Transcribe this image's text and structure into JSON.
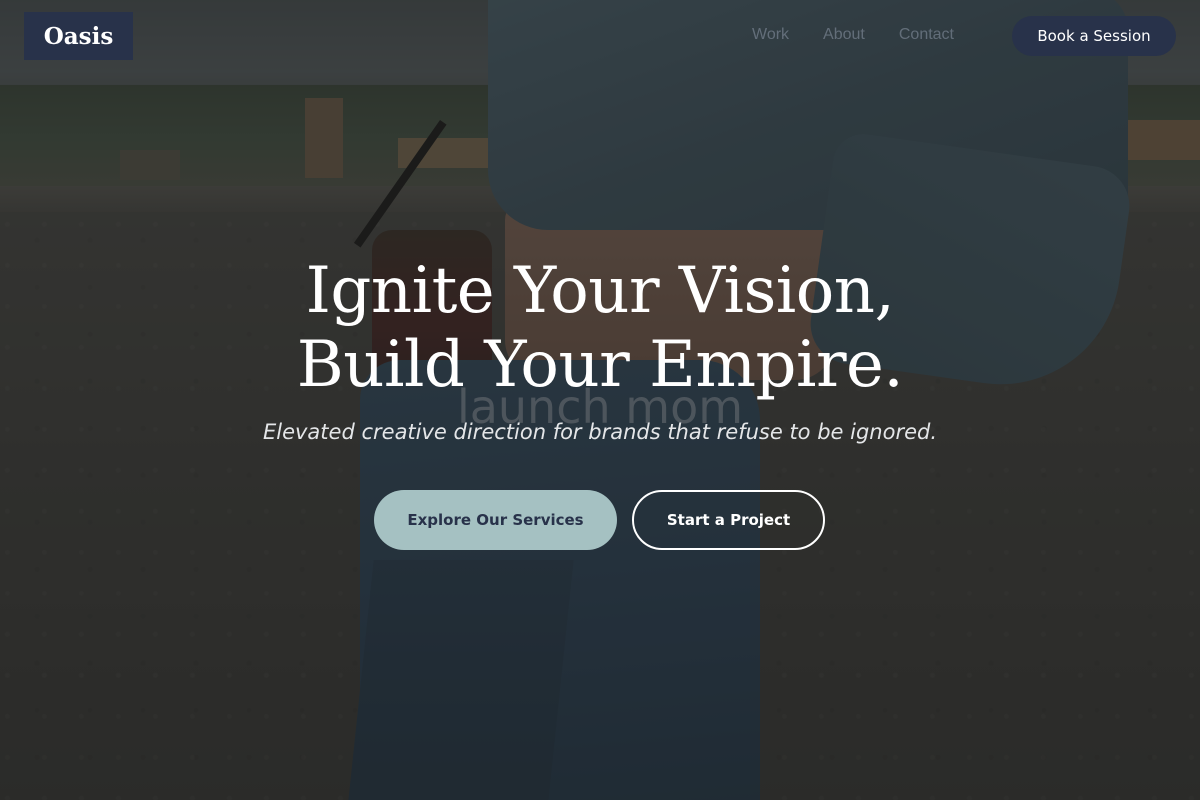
{
  "header": {
    "logo": "Oasis",
    "nav": [
      {
        "label": "Work"
      },
      {
        "label": "About"
      },
      {
        "label": "Contact"
      }
    ],
    "cta_label": "Book a Session"
  },
  "hero": {
    "title_line1": "Ignite Your Vision,",
    "title_line2": "Build Your Empire.",
    "watermark": "launch mom",
    "subtitle": "Elevated creative direction for brands that refuse to be ignored.",
    "primary_button": "Explore Our Services",
    "secondary_button": "Start a Project"
  },
  "colors": {
    "brand_navy": "#28324a",
    "accent_teal": "#a5c1c2",
    "text_light": "#ffffff"
  }
}
